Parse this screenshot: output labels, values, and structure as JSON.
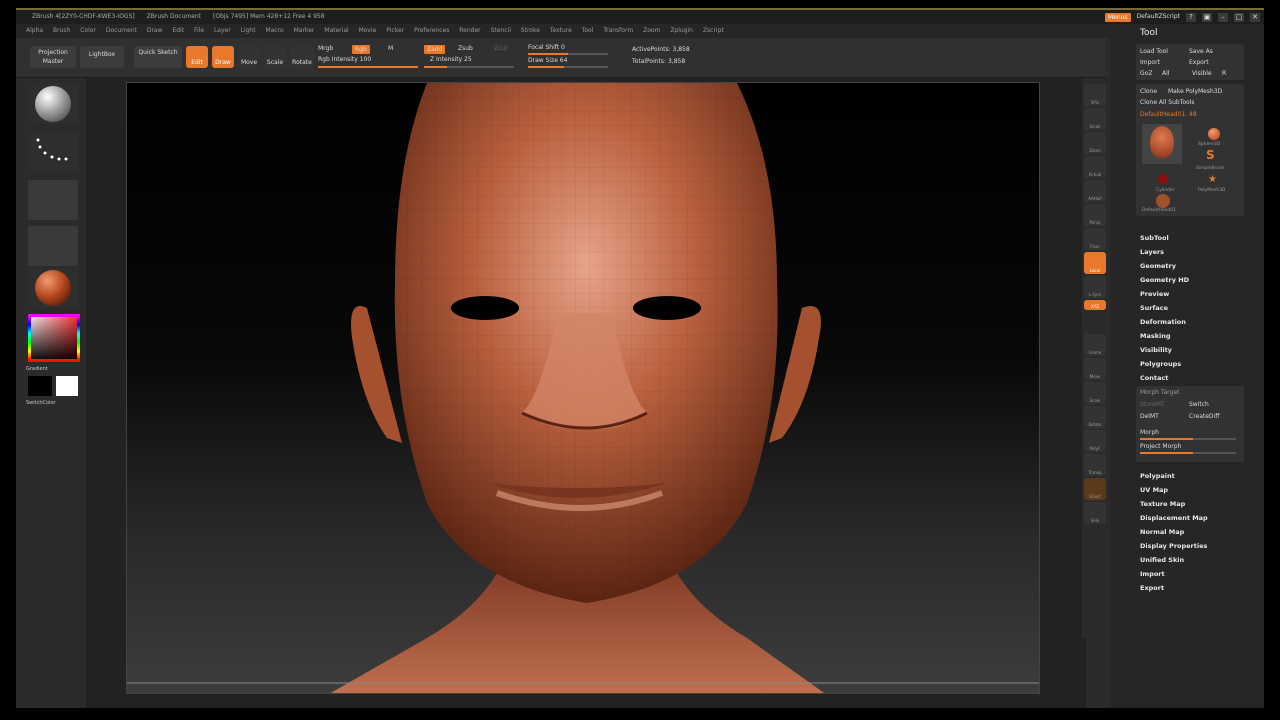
{
  "titlebar": {
    "app": "ZBrush 4[2ZY0-CHDF-KWE3-IOGS]",
    "document": "ZBrush Document",
    "stats": "[Objs 7495] Mem 428+12 Free 4 958",
    "badge": "Menus",
    "script": "DefaultZScript"
  },
  "menubar": [
    "Alpha",
    "Brush",
    "Color",
    "Document",
    "Draw",
    "Edit",
    "File",
    "Layer",
    "Light",
    "Macro",
    "Marker",
    "Material",
    "Movie",
    "Picker",
    "Preferences",
    "Render",
    "Stencil",
    "Stroke",
    "Texture",
    "Tool",
    "Transform",
    "Zoom",
    "Zplugin",
    "Zscript"
  ],
  "toolbar": {
    "projection_master": "Projection Master",
    "lightbox": "LightBox",
    "quick_sketch": "Quick Sketch",
    "edit": "Edit",
    "draw": "Draw",
    "move": "Move",
    "scale": "Scale",
    "rotate": "Rotate",
    "mrgb": "Mrgb",
    "rgb": "Rgb",
    "m": "M",
    "rgb_intensity": "Rgb Intensity 100",
    "zadd": "Zadd",
    "zsub": "Zsub",
    "zcut": "Zcut",
    "z_intensity": "Z Intensity 25",
    "focal_shift": "Focal Shift 0",
    "draw_size": "Draw Size 64",
    "active_points": "ActivePoints: 3,858",
    "total_points": "TotalPoints: 3,858"
  },
  "left_panel": {
    "gradient": "Gradient",
    "switch_color": "SwitchColor",
    "main_color": "#ff2a2a"
  },
  "right_icons": [
    "SPix",
    "Scroll",
    "Zoom",
    "Actual",
    "AAHalf",
    "Persp",
    "Floor",
    "Local",
    "L.Sym",
    "XYZ",
    "Frame",
    "Move",
    "Scale",
    "Rotate",
    "PolyF",
    "Transp",
    "Ghost",
    "Solo"
  ],
  "tool_panel": {
    "header": "Tool",
    "load_tool": "Load Tool",
    "save_as": "Save As",
    "import": "Import",
    "export": "Export",
    "goz": "GoZ",
    "all": "All",
    "visible": "Visible",
    "r": "R",
    "clone": "Clone",
    "make_polymesh": "Make PolyMesh3D",
    "clone_all": "Clone All SubTools",
    "current_tool": "DefaultHead01. 48",
    "thumbs": [
      "DefaultHead01",
      "Sphere3D",
      "SimpleBrush",
      "Cylinder",
      "PolyMesh3D",
      "DefaultHead01"
    ],
    "sections": [
      "SubTool",
      "Layers",
      "Geometry",
      "Geometry HD",
      "Preview",
      "Surface",
      "Deformation",
      "Masking",
      "Visibility",
      "Polygroups",
      "Contact"
    ],
    "morph_target": "Morph Target",
    "store_mt": "StoreMT",
    "switch": "Switch",
    "del_mt": "DelMT",
    "create_diff": "CreateDiff",
    "morph": "Morph",
    "project_morph": "Project Morph",
    "sections2": [
      "Polypaint",
      "UV Map",
      "Texture Map",
      "Displacement Map",
      "Normal Map",
      "Display Properties",
      "Unified Skin",
      "Import",
      "Export"
    ]
  },
  "colors": {
    "accent": "#e8782a",
    "skin": "#b85f3c"
  }
}
